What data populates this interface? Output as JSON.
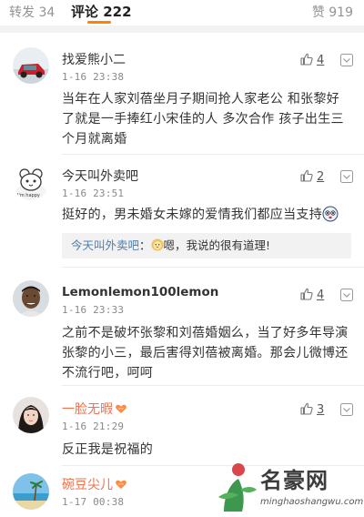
{
  "tabs": {
    "repost_label": "转发 34",
    "comment_label": "评论 222",
    "like_label": "赞 919"
  },
  "colors": {
    "accent": "#ff8200",
    "name_orange": "#eb7350",
    "reply_link": "#507daf"
  },
  "comments": [
    {
      "name": "找爱熊小二",
      "time": "1-16 23:38",
      "likes": "4",
      "text_lines": [
        "当年在人家刘蓓坐月子期间抢人家老公 和张黎好",
        "了就是一手捧红小宋佳的人 多次合作 孩子出生三",
        "个月就离婚"
      ],
      "avatar_icon": "avatar-car-icon"
    },
    {
      "name": "今天叫外卖吧",
      "time": "1-16 23:51",
      "likes": "2",
      "text_lines": [
        "挺好的，男未婚女未嫁的爱情我们都应当支持"
      ],
      "avatar_icon": "avatar-bear-icon",
      "reply": {
        "user": "今天叫外卖吧",
        "sep": "：",
        "text": "嗯，我说的很有道理!"
      }
    },
    {
      "name": "Lemonlemon100lemon",
      "time": "1-16 23:33",
      "likes": "4",
      "text_lines": [
        "之前不是破坏张黎和刘蓓婚姻么，当了好多年导演",
        "张黎的小三，最后害得刘蓓被离婚。那会儿微博还",
        "不流行吧，呵呵"
      ],
      "avatar_icon": "avatar-man-icon"
    },
    {
      "name": "一脸无暇",
      "time": "1-16 21:29",
      "likes": "3",
      "text_lines": [
        "反正我是祝福的"
      ],
      "avatar_icon": "avatar-woman-icon"
    },
    {
      "name": "碗豆尖儿",
      "time": "1-17 00:38",
      "avatar_icon": "avatar-beach-icon"
    }
  ],
  "watermark": {
    "title": "名豪网",
    "url": "minghaoshangwu.com"
  }
}
